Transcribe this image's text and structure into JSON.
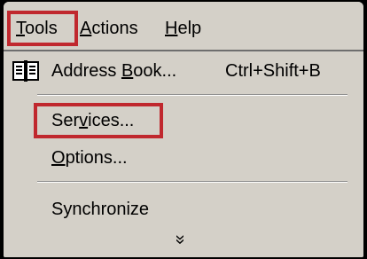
{
  "menubar": {
    "items": [
      {
        "label": "Tools",
        "mnemonic": "T",
        "rest": "ools",
        "highlighted": true
      },
      {
        "label": "Actions",
        "mnemonic": "A",
        "rest": "ctions"
      },
      {
        "label": "Help",
        "mnemonic": "H",
        "rest": "elp"
      }
    ]
  },
  "menu": {
    "items": [
      {
        "id": "address-book",
        "pre": "Address ",
        "mnemonic": "B",
        "post": "ook...",
        "shortcut": "Ctrl+Shift+B",
        "icon": "address-book-icon"
      },
      {
        "id": "services",
        "pre": "Ser",
        "mnemonic": "v",
        "post": "ices...",
        "highlighted": true
      },
      {
        "id": "options",
        "pre": "",
        "mnemonic": "O",
        "post": "ptions..."
      },
      {
        "id": "synchronize",
        "label": "Synchronize"
      }
    ],
    "expand_glyph": "»"
  },
  "colors": {
    "menu_bg": "#d4d0c8",
    "highlight_border": "#c0282e"
  }
}
